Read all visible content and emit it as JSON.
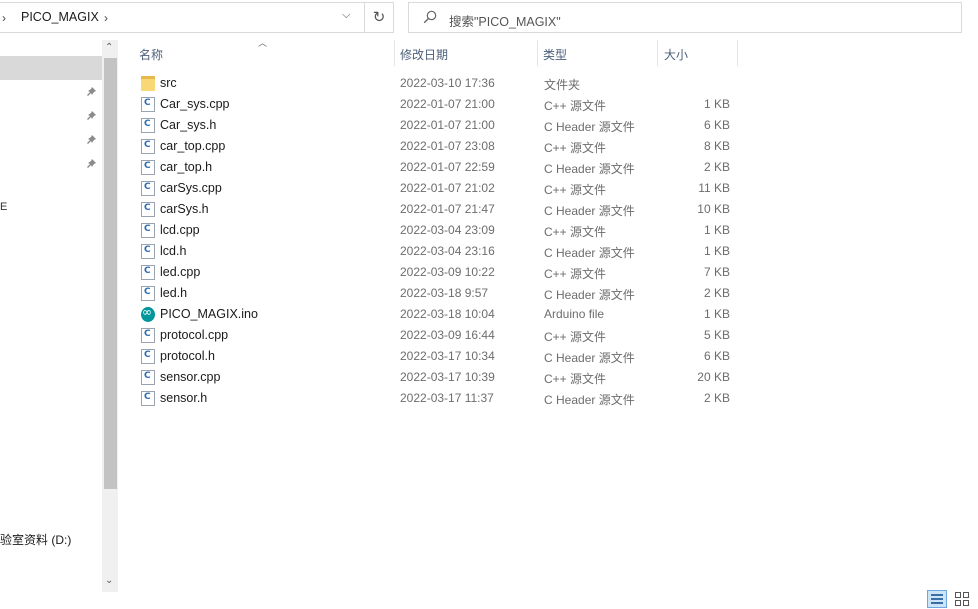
{
  "address_bar": {
    "breadcrumb": "PICO_MAGIX",
    "left_chevron_icon": "chevron-right-icon",
    "right_chevron_icon": "chevron-right-icon",
    "dropdown_icon": "chevron-down-icon",
    "refresh_icon": "refresh-icon",
    "refresh_glyph": "↻"
  },
  "search": {
    "placeholder": "搜索\"PICO_MAGIX\"",
    "icon": "search-icon"
  },
  "nav_pane": {
    "fragment_text": "E",
    "drive_label": "验室资料 (D:)",
    "pin_icon": "pin-icon",
    "pin_glyph": "📌"
  },
  "columns": {
    "name": "名称",
    "modified": "修改日期",
    "type": "类型",
    "size": "大小"
  },
  "files": [
    {
      "name": "src",
      "date": "2022-03-10 17:36",
      "type": "文件夹",
      "size": "",
      "icon": "folder-icon"
    },
    {
      "name": "Car_sys.cpp",
      "date": "2022-01-07 21:00",
      "type": "C++ 源文件",
      "size": "1 KB",
      "icon": "cpp-file-icon"
    },
    {
      "name": "Car_sys.h",
      "date": "2022-01-07 21:00",
      "type": "C Header 源文件",
      "size": "6 KB",
      "icon": "header-file-icon"
    },
    {
      "name": "car_top.cpp",
      "date": "2022-01-07 23:08",
      "type": "C++ 源文件",
      "size": "8 KB",
      "icon": "cpp-file-icon"
    },
    {
      "name": "car_top.h",
      "date": "2022-01-07 22:59",
      "type": "C Header 源文件",
      "size": "2 KB",
      "icon": "header-file-icon"
    },
    {
      "name": "carSys.cpp",
      "date": "2022-01-07 21:02",
      "type": "C++ 源文件",
      "size": "11 KB",
      "icon": "cpp-file-icon"
    },
    {
      "name": "carSys.h",
      "date": "2022-01-07 21:47",
      "type": "C Header 源文件",
      "size": "10 KB",
      "icon": "header-file-icon"
    },
    {
      "name": "lcd.cpp",
      "date": "2022-03-04 23:09",
      "type": "C++ 源文件",
      "size": "1 KB",
      "icon": "cpp-file-icon"
    },
    {
      "name": "lcd.h",
      "date": "2022-03-04 23:16",
      "type": "C Header 源文件",
      "size": "1 KB",
      "icon": "header-file-icon"
    },
    {
      "name": "led.cpp",
      "date": "2022-03-09 10:22",
      "type": "C++ 源文件",
      "size": "7 KB",
      "icon": "cpp-file-icon"
    },
    {
      "name": "led.h",
      "date": "2022-03-18 9:57",
      "type": "C Header 源文件",
      "size": "2 KB",
      "icon": "header-file-icon"
    },
    {
      "name": "PICO_MAGIX.ino",
      "date": "2022-03-18 10:04",
      "type": "Arduino file",
      "size": "1 KB",
      "icon": "arduino-file-icon"
    },
    {
      "name": "protocol.cpp",
      "date": "2022-03-09 16:44",
      "type": "C++ 源文件",
      "size": "5 KB",
      "icon": "cpp-file-icon"
    },
    {
      "name": "protocol.h",
      "date": "2022-03-17 10:34",
      "type": "C Header 源文件",
      "size": "6 KB",
      "icon": "header-file-icon"
    },
    {
      "name": "sensor.cpp",
      "date": "2022-03-17 10:39",
      "type": "C++ 源文件",
      "size": "20 KB",
      "icon": "cpp-file-icon"
    },
    {
      "name": "sensor.h",
      "date": "2022-03-17 11:37",
      "type": "C Header 源文件",
      "size": "2 KB",
      "icon": "header-file-icon"
    }
  ],
  "status_bar": {
    "details_view_icon": "details-view-icon",
    "large_icons_view_icon": "large-icons-view-icon"
  }
}
